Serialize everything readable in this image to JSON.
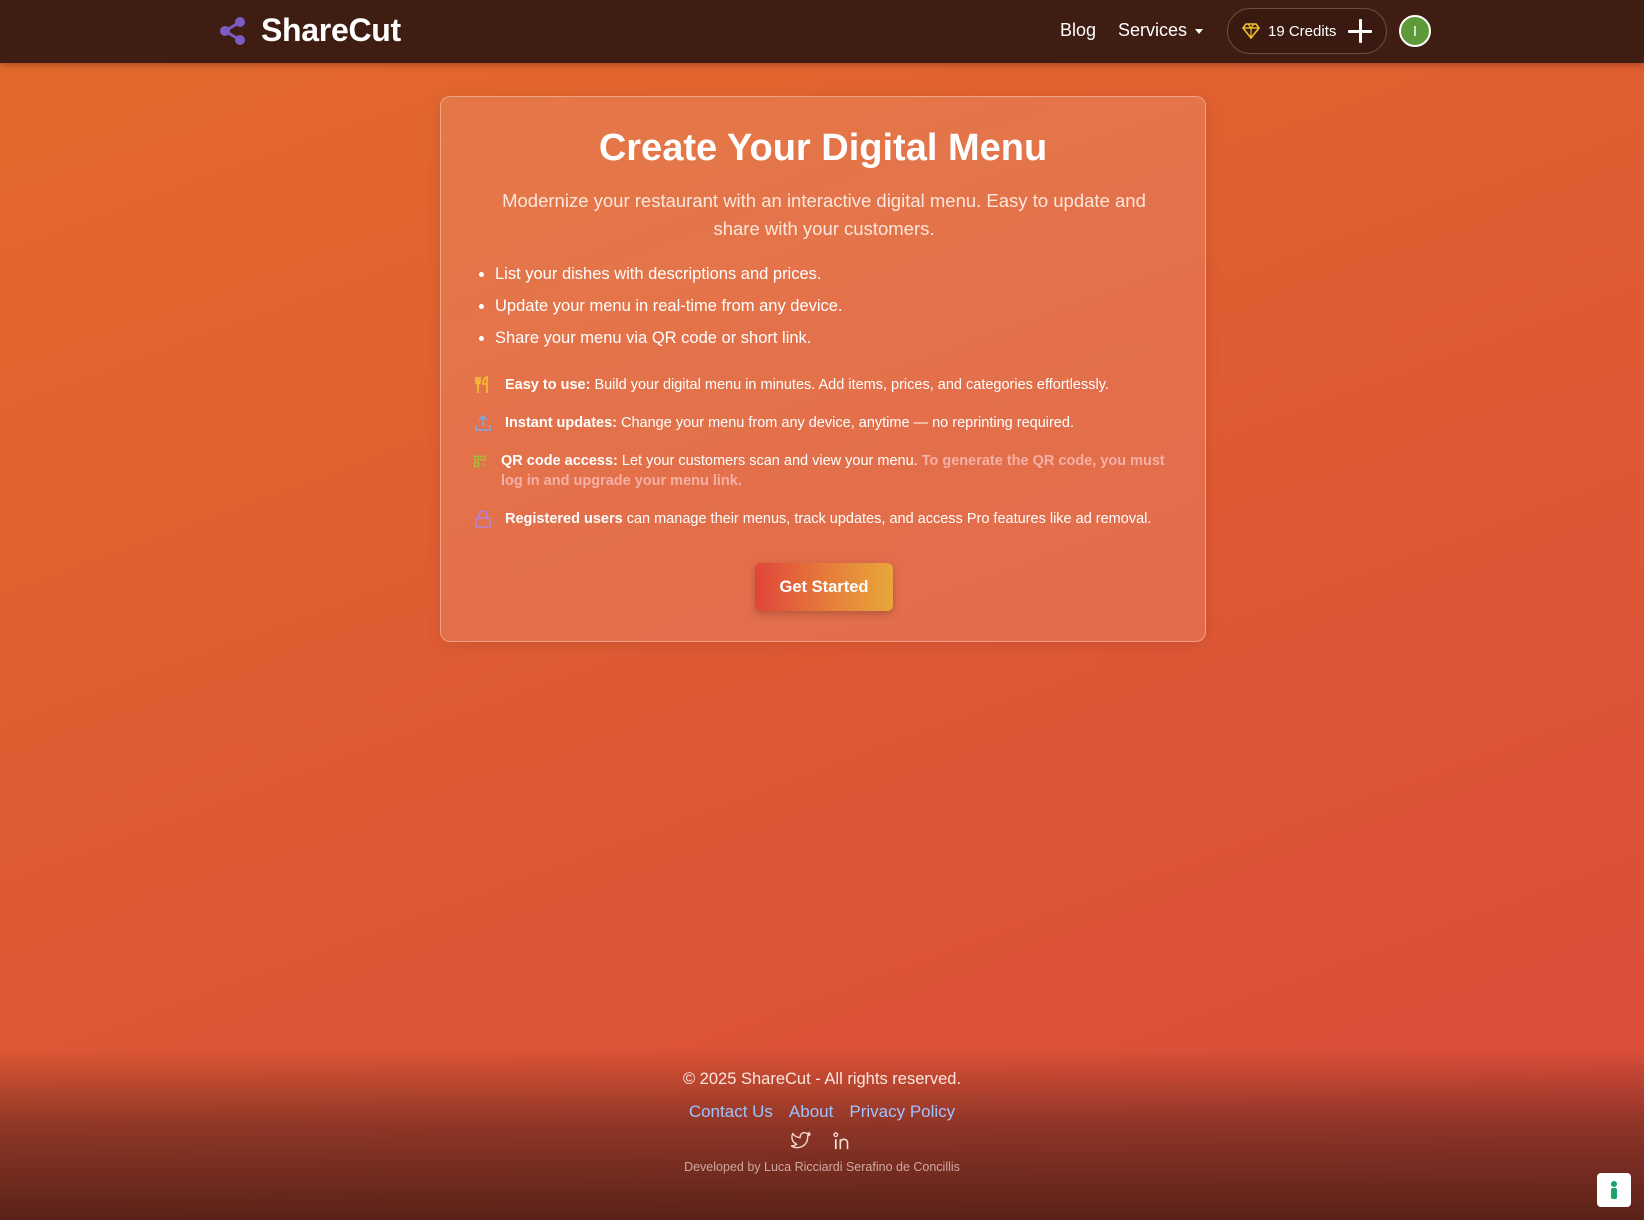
{
  "header": {
    "brand_name": "ShareCut",
    "nav": {
      "blog": "Blog",
      "services": "Services"
    },
    "credits_label": "19 Credits",
    "avatar_initial": "I"
  },
  "card": {
    "title": "Create Your Digital Menu",
    "subtitle": "Modernize your restaurant with an interactive digital menu. Easy to update and share with your customers.",
    "bullets": [
      "List your dishes with descriptions and prices.",
      "Update your menu in real-time from any device.",
      "Share your menu via QR code or short link."
    ],
    "features": [
      {
        "icon": "utensils-icon",
        "bold": "Easy to use:",
        "text": " Build your digital menu in minutes. Add items, prices, and categories effortlessly."
      },
      {
        "icon": "upload-icon",
        "bold": "Instant updates:",
        "text": " Change your menu from any device, anytime — no reprinting required."
      },
      {
        "icon": "qr-code-icon",
        "bold": "QR code access:",
        "text": " Let your customers scan and view your menu. ",
        "warning": "To generate the QR code, you must log in and upgrade your menu link."
      },
      {
        "icon": "lock-icon",
        "bold": "Registered users",
        "text": " can manage their menus, track updates, and access Pro features like ad removal."
      }
    ],
    "cta_label": "Get Started"
  },
  "footer": {
    "copyright": "© 2025 ShareCut - All rights reserved.",
    "links": [
      "Contact Us",
      "About",
      "Privacy Policy"
    ],
    "social": [
      "twitter-icon",
      "linkedin-icon"
    ],
    "developer": "Developed by Luca Ricciardi Serafino de Concillis"
  },
  "colors": {
    "header_bg": "#401d12",
    "link": "#9fc3ff",
    "avatar": "#5f9a3a",
    "brand_icon": "#7b5cc4"
  }
}
